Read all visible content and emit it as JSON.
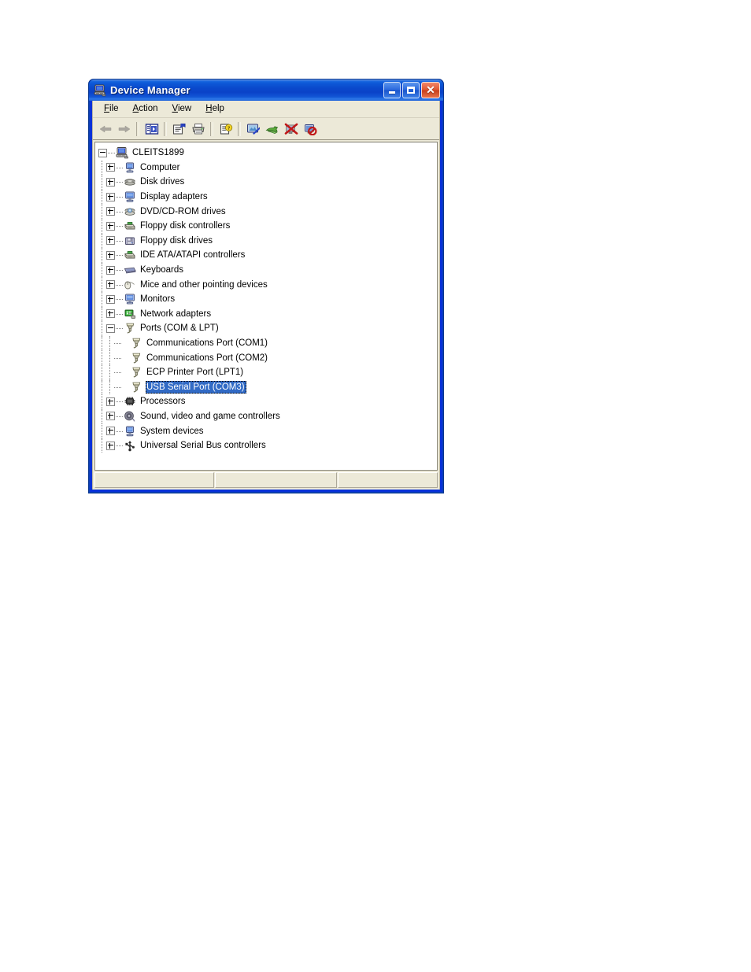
{
  "window": {
    "title": "Device Manager",
    "title_icon": "computer-icon",
    "buttons": {
      "minimize": "Minimize",
      "maximize": "Maximize",
      "close": "Close"
    },
    "colors": {
      "titlebar_blue": "#0a49cc",
      "client_bg": "#ece9d8",
      "selection_blue": "#316ac5",
      "tree_bg": "#ffffff"
    }
  },
  "menubar": {
    "items": [
      {
        "label": "File",
        "accel": "F",
        "pre": "",
        "post": "ile"
      },
      {
        "label": "Action",
        "accel": "A",
        "pre": "",
        "post": "ction"
      },
      {
        "label": "View",
        "accel": "V",
        "pre": "",
        "post": "iew"
      },
      {
        "label": "Help",
        "accel": "H",
        "pre": "",
        "post": "elp"
      }
    ]
  },
  "toolbar": {
    "items": [
      {
        "name": "back-arrow-icon",
        "label": "Back",
        "enabled": false
      },
      {
        "name": "forward-arrow-icon",
        "label": "Forward",
        "enabled": false
      },
      {
        "name": "show-hide-console-tree-icon",
        "label": "Show/Hide Console Tree",
        "enabled": true
      },
      {
        "name": "properties-icon",
        "label": "Properties",
        "enabled": true
      },
      {
        "name": "print-icon",
        "label": "Print",
        "enabled": true
      },
      {
        "name": "help-icon",
        "label": "Help",
        "enabled": true
      },
      {
        "name": "update-driver-icon",
        "label": "Update Driver",
        "enabled": true
      },
      {
        "name": "scan-hardware-changes-icon",
        "label": "Scan for hardware changes",
        "enabled": true
      },
      {
        "name": "disable-device-icon",
        "label": "Disable",
        "enabled": true
      },
      {
        "name": "uninstall-device-icon",
        "label": "Uninstall",
        "enabled": true
      }
    ]
  },
  "tree": {
    "nodes": [
      {
        "label": "CLEITS1899",
        "depth": 0,
        "expander": "minus",
        "icon": "computer-icon",
        "selected": false
      },
      {
        "label": "Computer",
        "depth": 1,
        "expander": "plus",
        "icon": "computer-node-icon",
        "selected": false
      },
      {
        "label": "Disk drives",
        "depth": 1,
        "expander": "plus",
        "icon": "disk-drive-icon",
        "selected": false
      },
      {
        "label": "Display adapters",
        "depth": 1,
        "expander": "plus",
        "icon": "display-adapter-icon",
        "selected": false
      },
      {
        "label": "DVD/CD-ROM drives",
        "depth": 1,
        "expander": "plus",
        "icon": "dvd-drive-icon",
        "selected": false
      },
      {
        "label": "Floppy disk controllers",
        "depth": 1,
        "expander": "plus",
        "icon": "controller-icon",
        "selected": false
      },
      {
        "label": "Floppy disk drives",
        "depth": 1,
        "expander": "plus",
        "icon": "floppy-drive-icon",
        "selected": false
      },
      {
        "label": "IDE ATA/ATAPI controllers",
        "depth": 1,
        "expander": "plus",
        "icon": "controller-icon",
        "selected": false
      },
      {
        "label": "Keyboards",
        "depth": 1,
        "expander": "plus",
        "icon": "keyboard-icon",
        "selected": false
      },
      {
        "label": "Mice and other pointing devices",
        "depth": 1,
        "expander": "plus",
        "icon": "mouse-icon",
        "selected": false
      },
      {
        "label": "Monitors",
        "depth": 1,
        "expander": "plus",
        "icon": "monitor-icon",
        "selected": false
      },
      {
        "label": "Network adapters",
        "depth": 1,
        "expander": "plus",
        "icon": "network-adapter-icon",
        "selected": false
      },
      {
        "label": "Ports (COM & LPT)",
        "depth": 1,
        "expander": "minus",
        "icon": "port-icon",
        "selected": false
      },
      {
        "label": "Communications Port (COM1)",
        "depth": 2,
        "expander": "none",
        "icon": "port-icon",
        "selected": false
      },
      {
        "label": "Communications Port (COM2)",
        "depth": 2,
        "expander": "none",
        "icon": "port-icon",
        "selected": false
      },
      {
        "label": "ECP Printer Port (LPT1)",
        "depth": 2,
        "expander": "none",
        "icon": "port-icon",
        "selected": false
      },
      {
        "label": "USB Serial Port (COM3)",
        "depth": 2,
        "expander": "none",
        "icon": "port-icon",
        "selected": true
      },
      {
        "label": "Processors",
        "depth": 1,
        "expander": "plus",
        "icon": "processor-icon",
        "selected": false
      },
      {
        "label": "Sound, video and game controllers",
        "depth": 1,
        "expander": "plus",
        "icon": "sound-icon",
        "selected": false
      },
      {
        "label": "System devices",
        "depth": 1,
        "expander": "plus",
        "icon": "system-device-icon",
        "selected": false
      },
      {
        "label": "Universal Serial Bus controllers",
        "depth": 1,
        "expander": "plus",
        "icon": "usb-icon",
        "selected": false
      }
    ]
  },
  "statusbar": {
    "pane1": "",
    "pane2": "",
    "pane3": ""
  }
}
